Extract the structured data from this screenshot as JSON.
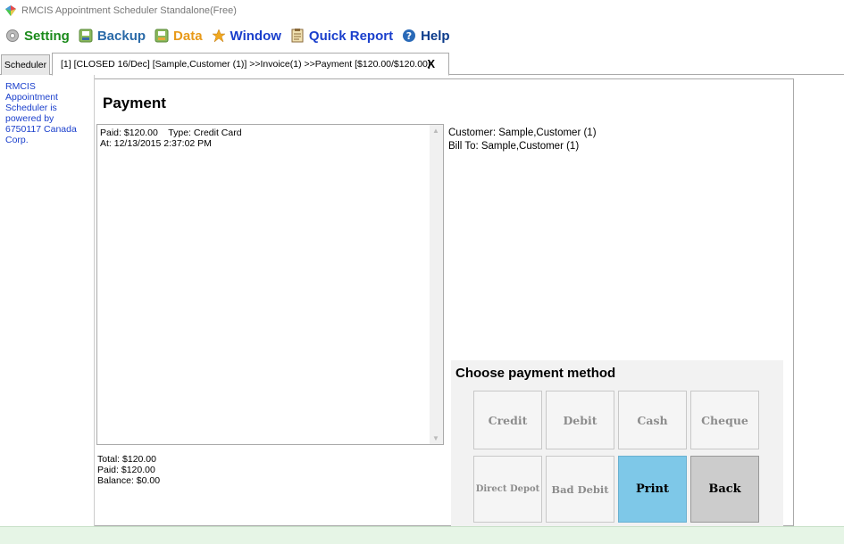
{
  "window": {
    "title": "RMCIS Appointment Scheduler Standalone(Free)"
  },
  "menu": {
    "items": [
      {
        "label": "Setting",
        "icon": "gear-icon",
        "color": "#1a8a1a"
      },
      {
        "label": "Backup",
        "icon": "backup-icon",
        "color": "#2a6aa8"
      },
      {
        "label": "Data",
        "icon": "data-icon",
        "color": "#e89a1a"
      },
      {
        "label": "Window",
        "icon": "window-icon",
        "color": "#1a3fcc"
      },
      {
        "label": "Quick Report",
        "icon": "report-icon",
        "color": "#1a3fcc"
      },
      {
        "label": "Help",
        "icon": "help-icon",
        "color": "#0a3a8a"
      }
    ]
  },
  "tabs": {
    "scheduler": "Scheduler",
    "active": "[1] [CLOSED 16/Dec] [Sample,Customer (1)] >>Invoice(1) >>Payment [$120.00/$120.00]",
    "close": "X"
  },
  "sidebar": {
    "powered_by": "RMCIS Appointment Scheduler is powered by 6750117 Canada Corp."
  },
  "payment": {
    "title": "Payment",
    "detail_line1": "Paid: $120.00    Type: Credit Card",
    "detail_line2": "At: 12/13/2015 2:37:02 PM",
    "total": "Total: $120.00",
    "paid": "Paid: $120.00",
    "balance": "Balance: $0.00",
    "customer": "Customer: Sample,Customer (1)",
    "bill_to": "Bill To: Sample,Customer (1)",
    "choose_title": "Choose payment method",
    "buttons": {
      "credit": "Credit",
      "debit": "Debit",
      "cash": "Cash",
      "cheque": "Cheque",
      "direct_depot": "Direct Depot",
      "bad_debit": "Bad Debit",
      "print": "Print",
      "back": "Back"
    }
  },
  "colors": {
    "print_button": "#7ec8e8",
    "back_button": "#cccccc",
    "status_bar": "#e6f5e6",
    "link_blue": "#1a3fcc"
  }
}
